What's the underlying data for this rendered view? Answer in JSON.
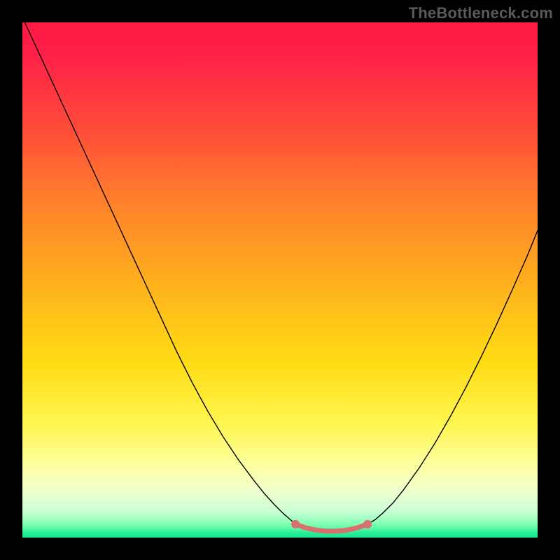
{
  "watermark": "TheBottleneck.com",
  "chart_data": {
    "type": "line",
    "title": "",
    "xlabel": "",
    "ylabel": "",
    "xlim": [
      0,
      100
    ],
    "ylim": [
      0,
      100
    ],
    "axes_hidden": true,
    "background": {
      "type": "vertical-gradient",
      "stops": [
        {
          "pos": 0.0,
          "color": "#ff1a46"
        },
        {
          "pos": 0.06,
          "color": "#ff1f48"
        },
        {
          "pos": 0.2,
          "color": "#ff4a3a"
        },
        {
          "pos": 0.36,
          "color": "#ff842a"
        },
        {
          "pos": 0.52,
          "color": "#ffb41c"
        },
        {
          "pos": 0.66,
          "color": "#ffdc14"
        },
        {
          "pos": 0.78,
          "color": "#fff650"
        },
        {
          "pos": 0.86,
          "color": "#fcffa0"
        },
        {
          "pos": 0.91,
          "color": "#f0ffce"
        },
        {
          "pos": 0.95,
          "color": "#c8ffd4"
        },
        {
          "pos": 0.975,
          "color": "#7effb0"
        },
        {
          "pos": 0.99,
          "color": "#2cf09a"
        },
        {
          "pos": 1.0,
          "color": "#17e28e"
        }
      ]
    },
    "series": [
      {
        "name": "bottleneck-curve-left",
        "color": "#000000",
        "width": 1.4,
        "x": [
          0,
          3,
          6,
          9,
          12,
          15,
          18,
          21,
          24,
          27,
          30,
          33,
          36,
          39,
          42,
          45,
          47,
          49,
          50.5,
          52,
          53
        ],
        "y": [
          101,
          94.5,
          88,
          81.5,
          75,
          68.5,
          62,
          55.5,
          49,
          42.5,
          36,
          30,
          24.5,
          19.5,
          15,
          11,
          8.5,
          6.3,
          4.8,
          3.5,
          2.6
        ]
      },
      {
        "name": "bottleneck-curve-right",
        "color": "#000000",
        "width": 1.4,
        "x": [
          67,
          68.5,
          70,
          72,
          74,
          77,
          80,
          83,
          86,
          89,
          92,
          95,
          98,
          100
        ],
        "y": [
          2.6,
          3.5,
          4.8,
          6.8,
          9.3,
          13.5,
          18.2,
          23.4,
          29.0,
          35.0,
          41.3,
          47.9,
          54.7,
          59.6
        ]
      },
      {
        "name": "optimal-band",
        "type": "marker+line",
        "color": "#d9706e",
        "marker_radius": 6,
        "line_width": 7,
        "x": [
          53,
          55,
          57,
          59,
          61,
          63,
          65,
          67
        ],
        "y": [
          2.6,
          1.9,
          1.45,
          1.25,
          1.25,
          1.45,
          1.9,
          2.6
        ]
      }
    ]
  }
}
